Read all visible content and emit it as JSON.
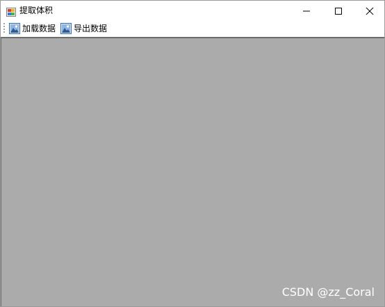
{
  "window": {
    "title": "提取体积"
  },
  "toolbar": {
    "buttons": [
      {
        "label": "加载数据",
        "icon": "picture-icon"
      },
      {
        "label": "导出数据",
        "icon": "picture-icon"
      }
    ]
  },
  "watermark": {
    "text": "CSDN @zz_Coral"
  },
  "colors": {
    "content_background": "#ababab",
    "window_background": "#ffffff"
  }
}
